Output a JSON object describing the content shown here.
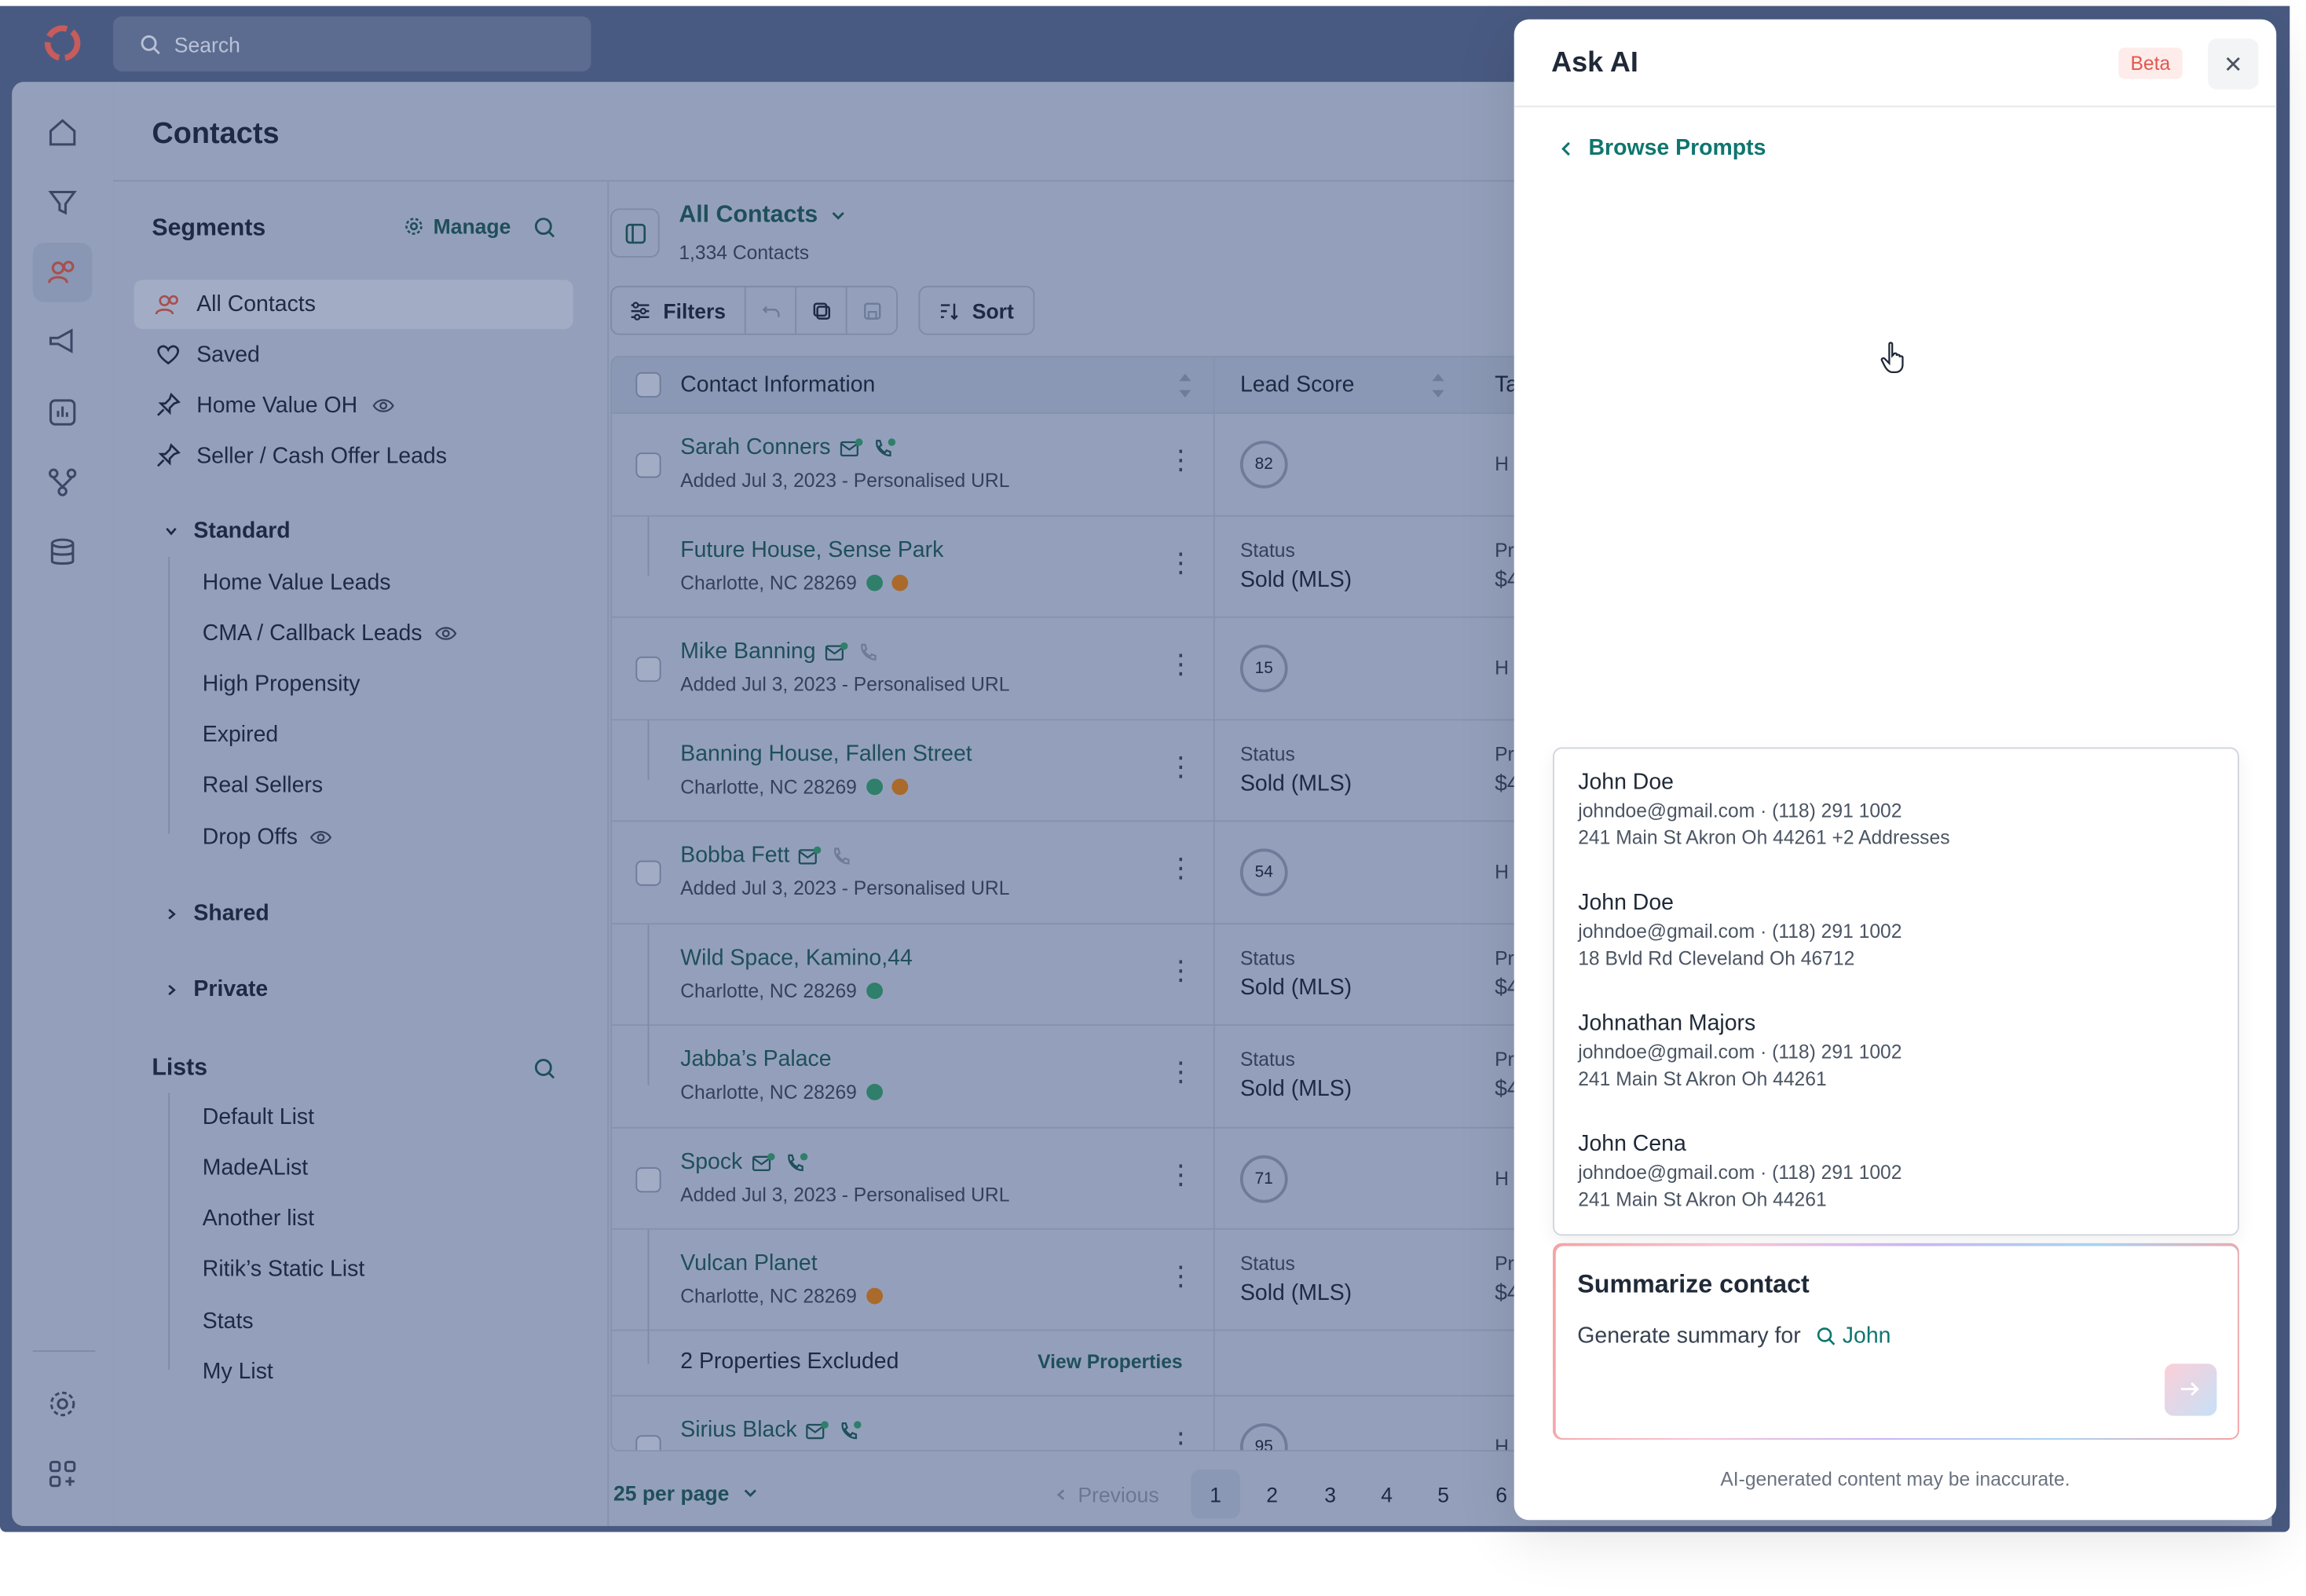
{
  "search": {
    "placeholder": "Search"
  },
  "page": {
    "title": "Contacts"
  },
  "segments": {
    "title": "Segments",
    "manage_label": "Manage",
    "items": [
      {
        "label": "All Contacts",
        "icon": "users-icon"
      },
      {
        "label": "Saved",
        "icon": "heart-icon"
      },
      {
        "label": "Home Value OH",
        "icon": "pin-icon",
        "watch": true
      },
      {
        "label": "Seller / Cash Offer Leads",
        "icon": "pin-icon"
      }
    ],
    "groups": {
      "standard": {
        "label": "Standard",
        "items": [
          "Home Value Leads",
          "CMA / Callback Leads",
          "High Propensity",
          "Expired",
          "Real Sellers",
          "Drop Offs"
        ]
      },
      "shared": {
        "label": "Shared"
      },
      "private": {
        "label": "Private"
      }
    }
  },
  "lists": {
    "title": "Lists",
    "items": [
      "Default List",
      "MadeAList",
      "Another list",
      "Ritik’s Static List",
      "Stats",
      "My List"
    ]
  },
  "contacts": {
    "view_name": "All Contacts",
    "count": "1,334 Contacts",
    "toolbar": {
      "filters": "Filters",
      "sort": "Sort"
    },
    "columns": {
      "contact": "Contact Information",
      "lead": "Lead Score",
      "cut": "Ta"
    },
    "rows": [
      {
        "type": "contact",
        "name": "Sarah Conners",
        "sub": "Added Jul 3, 2023 - Personalised URL",
        "score": "82",
        "cut": "H"
      },
      {
        "type": "property",
        "name": "Future House, Sense Park",
        "sub": "Charlotte, NC 28269",
        "status_label": "Status",
        "status": "Sold (MLS)",
        "cut": "Pr",
        "cut2": "$4"
      },
      {
        "type": "contact",
        "name": "Mike Banning",
        "sub": "Added Jul 3, 2023 - Personalised URL",
        "score": "15",
        "cut": "H"
      },
      {
        "type": "property",
        "name": "Banning House, Fallen Street",
        "sub": "Charlotte, NC 28269",
        "status_label": "Status",
        "status": "Sold (MLS)",
        "cut": "Pr",
        "cut2": "$4"
      },
      {
        "type": "contact",
        "name": "Bobba Fett",
        "sub": "Added Jul 3, 2023 - Personalised URL",
        "score": "54",
        "cut": "H"
      },
      {
        "type": "property",
        "name": "Wild Space, Kamino,44",
        "sub": "Charlotte, NC 28269",
        "status_label": "Status",
        "status": "Sold (MLS)",
        "cut": "Pr",
        "cut2": "$4"
      },
      {
        "type": "property",
        "name": "Jabba’s Palace",
        "sub": "Charlotte, NC 28269",
        "status_label": "Status",
        "status": "Sold (MLS)",
        "cut": "Pr",
        "cut2": "$4"
      },
      {
        "type": "contact",
        "name": "Spock",
        "sub": "Added Jul 3, 2023 - Personalised URL",
        "score": "71",
        "cut": "H"
      },
      {
        "type": "property",
        "name": "Vulcan Planet",
        "sub": "Charlotte, NC 28269",
        "status_label": "Status",
        "status": "Sold (MLS)",
        "cut": "Pr",
        "cut2": "$4"
      }
    ],
    "excluded": {
      "label": "2 Properties Excluded",
      "link": "View  Properties"
    },
    "last_row": {
      "name": "Sirius Black",
      "score": "95",
      "cut": "H"
    },
    "pager": {
      "per_page": "25 per page",
      "previous": "Previous",
      "pages": [
        "1",
        "2",
        "3",
        "4",
        "5",
        "6"
      ],
      "current": "1"
    }
  },
  "ai": {
    "title": "Ask AI",
    "badge": "Beta",
    "browse": "Browse Prompts",
    "suggestions": [
      {
        "name": "John Doe",
        "contact": "johndoe@gmail.com · (118) 291 1002",
        "address": "241 Main St Akron Oh 44261 +2 Addresses"
      },
      {
        "name": "John Doe",
        "contact": "johndoe@gmail.com · (118) 291 1002",
        "address": "18 Bvld Rd Cleveland Oh 46712"
      },
      {
        "name": "Johnathan Majors",
        "contact": "johndoe@gmail.com · (118) 291 1002",
        "address": "241 Main St Akron Oh 44261"
      },
      {
        "name": "John Cena",
        "contact": "johndoe@gmail.com · (118) 291 1002",
        "address": "241 Main St Akron Oh 44261"
      }
    ],
    "prompt": {
      "title": "Summarize contact",
      "text": "Generate summary for",
      "query": "John"
    },
    "disclaimer": "AI-generated content may be inaccurate."
  },
  "colors": {
    "accent": "#0f766e",
    "beta": "#e0584f",
    "overlay": "#495a82"
  }
}
